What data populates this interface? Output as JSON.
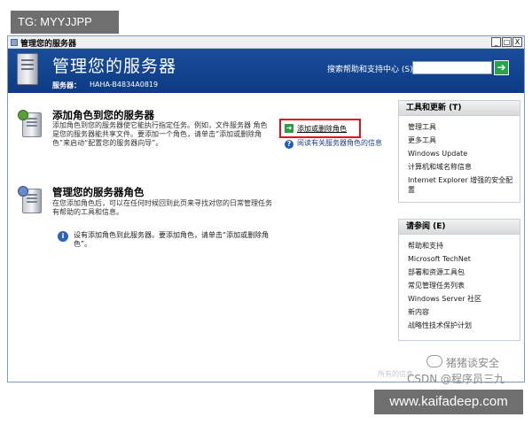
{
  "tags": {
    "top_left": "TG: MYYJJPP",
    "bottom_right": "www.kaifadeep.com"
  },
  "window": {
    "title": "管理您的服务器",
    "buttons": [
      "_",
      "□",
      "X"
    ]
  },
  "banner": {
    "title": "管理您的服务器",
    "server_label": "服务器：",
    "server_name": "HAHA-B4834A0819",
    "search_label": "搜索帮助和支持中心 (S)",
    "search_value": "",
    "go_icon": "➔"
  },
  "section1": {
    "heading": "添加角色到您的服务器",
    "body": "添加角色到您的服务器使它能执行指定任务。例如，文件服务器 角色是您的服务器能共享文件。要添加一个角色，请单击“添加或删除角色”来启动“配置您的服务器向导”。",
    "add_remove_link": "添加或删除角色",
    "add_remove_icon": "➔",
    "read_more_link": "阅读有关服务器角色的信息",
    "info_icon": "?"
  },
  "section2": {
    "heading": "管理您的服务器角色",
    "body": "在您添加角色后，可以在任何时候回到此页来寻找对您的日常管理任务有帮助的工具和信息。",
    "note": "设有添加角色到此服务器。要添加角色，请单击“添加或删除角色”。",
    "note_icon": "i"
  },
  "panel_tools": {
    "title": "工具和更新 (T)",
    "items": [
      "管理工具",
      "更多工具",
      "Windows Update",
      "计算机和域名称信息",
      "Internet Explorer 增强的安全配置"
    ]
  },
  "panel_seealso": {
    "title": "请参阅 (E)",
    "items": [
      "帮助和支持",
      "Microsoft TechNet",
      "部署和资源工具包",
      "常见管理任务列表",
      "Windows Server 社区",
      "新内容",
      "战略性技术保护计划"
    ]
  },
  "watermarks": {
    "faint": "所有的信息",
    "wechat": "猪猪谈安全",
    "csdn": "CSDN @程序员三九"
  }
}
